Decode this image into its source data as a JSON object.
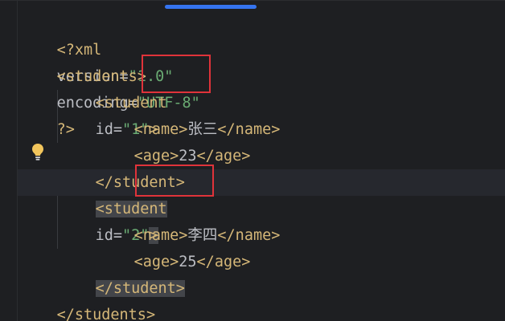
{
  "editor": {
    "lines": [
      {
        "declaration_open": "<?xml",
        "version_attr": "version",
        "version_value": "\"1.0\"",
        "encoding_attr": "encoding",
        "encoding_value": "\"UTF-8\"",
        "declaration_close": "?>"
      },
      {
        "tag": "<students>"
      },
      {
        "tag_open": "<student",
        "attr": "id",
        "eq": "=",
        "value": "\"1\"",
        "tag_close": ">"
      },
      {
        "open": "<name>",
        "text": "张三",
        "close": "</name>"
      },
      {
        "open": "<age>",
        "text": "23",
        "close": "</age>"
      },
      {
        "tag": "</student>"
      },
      {
        "tag_open": "<student",
        "attr": "id",
        "eq": "=",
        "value": "\"2\"",
        "tag_close": ">"
      },
      {
        "open": "<name>",
        "text": "李四",
        "close": "</name>"
      },
      {
        "open": "<age>",
        "text": "25",
        "close": "</age>"
      },
      {
        "tag": "</student>"
      },
      {
        "tag": "</students>"
      }
    ],
    "colors": {
      "background": "#1e1f22",
      "tag": "#d5b778",
      "string": "#6aab73",
      "text": "#bcbec4",
      "highlight_box": "#e0333a",
      "scrollbar": "#3574f0",
      "intention_bulb": "#f2c55c"
    },
    "icons": [
      "intention-bulb-icon"
    ]
  }
}
